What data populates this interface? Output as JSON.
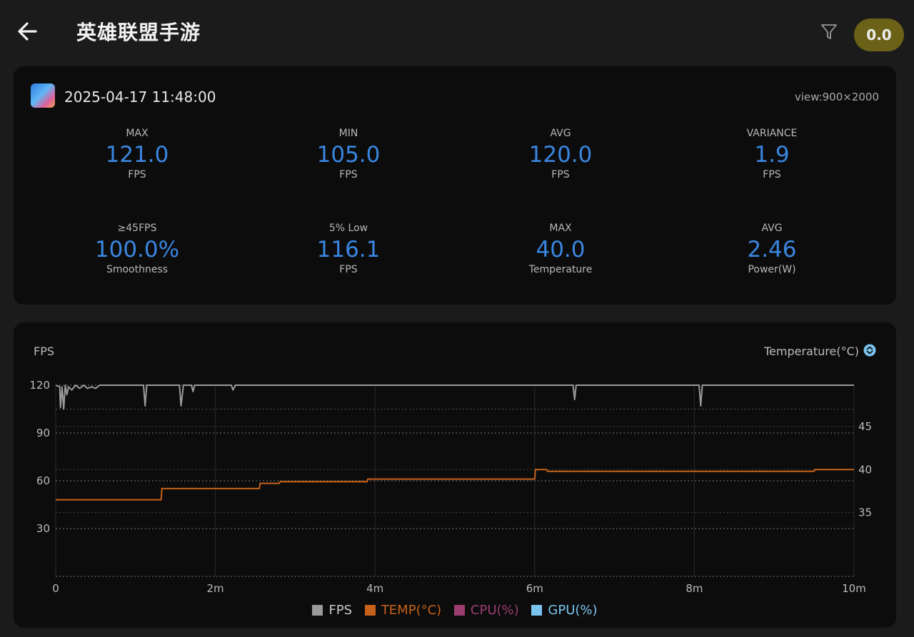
{
  "header": {
    "title": "英雄联盟手游",
    "score": "0.0"
  },
  "session": {
    "datetime": "2025-04-17 11:48:00",
    "view": "view:900×2000"
  },
  "stats": [
    {
      "label": "MAX",
      "value": "121.0",
      "unit": "FPS"
    },
    {
      "label": "MIN",
      "value": "105.0",
      "unit": "FPS"
    },
    {
      "label": "AVG",
      "value": "120.0",
      "unit": "FPS"
    },
    {
      "label": "VARIANCE",
      "value": "1.9",
      "unit": "FPS"
    },
    {
      "label": "≥45FPS",
      "value": "100.0%",
      "unit": "Smoothness"
    },
    {
      "label": "5% Low",
      "value": "116.1",
      "unit": "FPS"
    },
    {
      "label": "MAX",
      "value": "40.0",
      "unit": "Temperature"
    },
    {
      "label": "AVG",
      "value": "2.46",
      "unit": "Power(W)"
    }
  ],
  "colors": {
    "accent": "#3a86e0",
    "fps": "#9a9a9a",
    "temp": "#c8621a",
    "cpu": "#9c3d6f",
    "gpu": "#7cc4f0"
  },
  "chart_data": {
    "type": "line",
    "ylabel": "FPS",
    "y2label": "Temperature(°C)",
    "x_ticks": [
      "0",
      "2m",
      "4m",
      "6m",
      "8m",
      "10m"
    ],
    "xlim": [
      0,
      10
    ],
    "ylim": [
      0,
      120
    ],
    "y_ticks": [
      "30",
      "60",
      "90",
      "120"
    ],
    "y2_ticks": [
      "35",
      "40",
      "45"
    ],
    "y2lim": [
      27.6,
      49.8
    ],
    "grid": true,
    "legend_position": "bottom",
    "series": [
      {
        "name": "FPS",
        "axis": "left",
        "x": [
          0,
          0.05,
          0.06,
          0.08,
          0.1,
          0.12,
          0.14,
          0.16,
          0.2,
          0.25,
          0.3,
          0.35,
          0.4,
          0.45,
          0.5,
          0.55,
          0.6,
          0.8,
          1.0,
          1.1,
          1.12,
          1.14,
          1.2,
          1.5,
          1.55,
          1.57,
          1.6,
          1.7,
          1.72,
          1.74,
          2.0,
          2.2,
          2.22,
          2.25,
          2.5,
          3.0,
          3.5,
          4.0,
          4.5,
          5.0,
          5.5,
          6.0,
          6.48,
          6.5,
          6.52,
          7.0,
          7.5,
          8.0,
          8.06,
          8.08,
          8.1,
          8.5,
          9.0,
          9.5,
          10.0
        ],
        "y": [
          120,
          119,
          106,
          119,
          105,
          120,
          114,
          119,
          117,
          120,
          118,
          120,
          118,
          119,
          118,
          120,
          120,
          120,
          120,
          120,
          107,
          120,
          120,
          120,
          120,
          107,
          120,
          120,
          116,
          120,
          120,
          120,
          117,
          120,
          120,
          120,
          120,
          120,
          120,
          120,
          120,
          120,
          120,
          111,
          120,
          120,
          120,
          120,
          120,
          107,
          120,
          120,
          120,
          120,
          120
        ]
      },
      {
        "name": "TEMP(°C)",
        "axis": "right",
        "x": [
          0,
          1.32,
          1.33,
          2.55,
          2.56,
          2.8,
          2.81,
          3.9,
          3.91,
          6.0,
          6.01,
          6.15,
          6.16,
          9.5,
          9.51,
          10.0
        ],
        "y": [
          36.5,
          36.5,
          37.8,
          37.8,
          38.4,
          38.4,
          38.6,
          38.6,
          38.9,
          38.9,
          40.0,
          40.0,
          39.8,
          39.8,
          40.0,
          40.0
        ]
      },
      {
        "name": "CPU(%)",
        "axis": "left",
        "x": [],
        "y": []
      },
      {
        "name": "GPU(%)",
        "axis": "left",
        "x": [],
        "y": []
      }
    ]
  }
}
